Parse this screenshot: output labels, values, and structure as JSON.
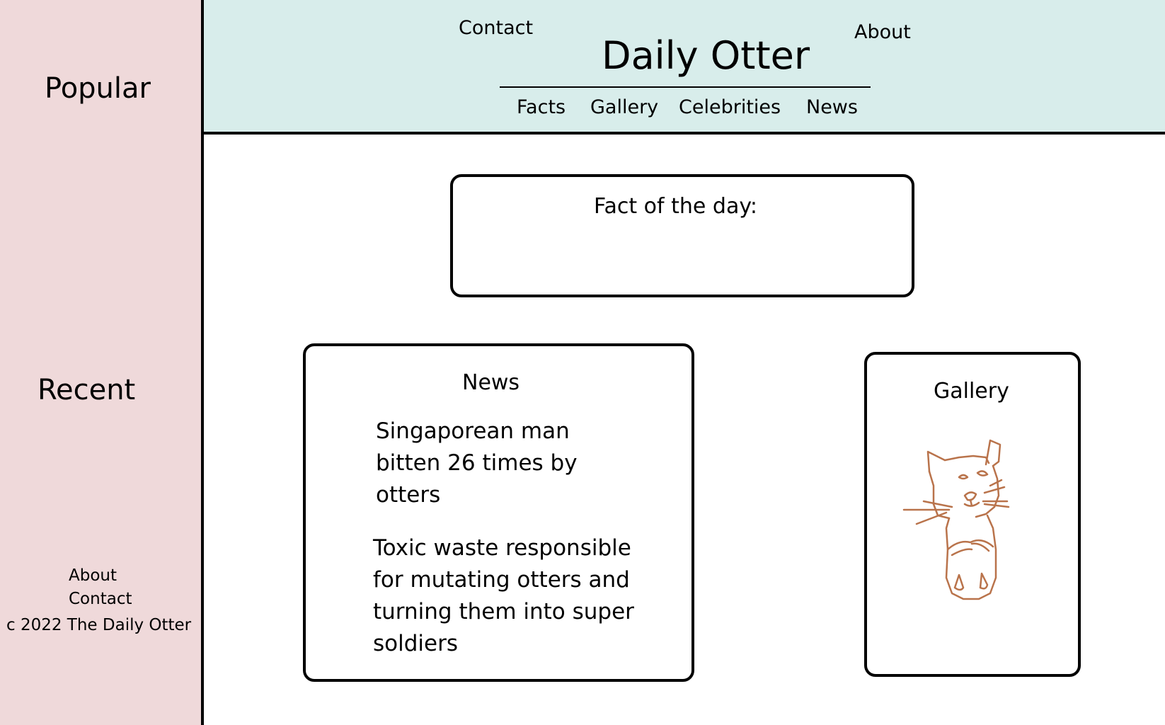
{
  "sidebar": {
    "popular_heading": "Popular",
    "recent_heading": "Recent",
    "footer_links": {
      "about": "About",
      "contact": "Contact"
    },
    "copyright": "c 2022 The Daily Otter"
  },
  "header": {
    "site_title": "Daily Otter",
    "contact_link": "Contact",
    "about_link": "About",
    "nav": {
      "facts": "Facts",
      "gallery": "Gallery",
      "celebrities": "Celebrities",
      "news": "News"
    }
  },
  "fact_card": {
    "title": "Fact of the day:"
  },
  "news_card": {
    "title": "News",
    "items": [
      "Singaporean man bitten 26 times by otters",
      "Toxic waste responsible for mutating otters and turning them into super soldiers"
    ]
  },
  "gallery_card": {
    "title": "Gallery",
    "drawing_icon": "otter-drawing"
  },
  "colors": {
    "sidebar_bg": "#efd9da",
    "header_bg": "#d8edeb",
    "drawing_stroke": "#b9734b"
  }
}
